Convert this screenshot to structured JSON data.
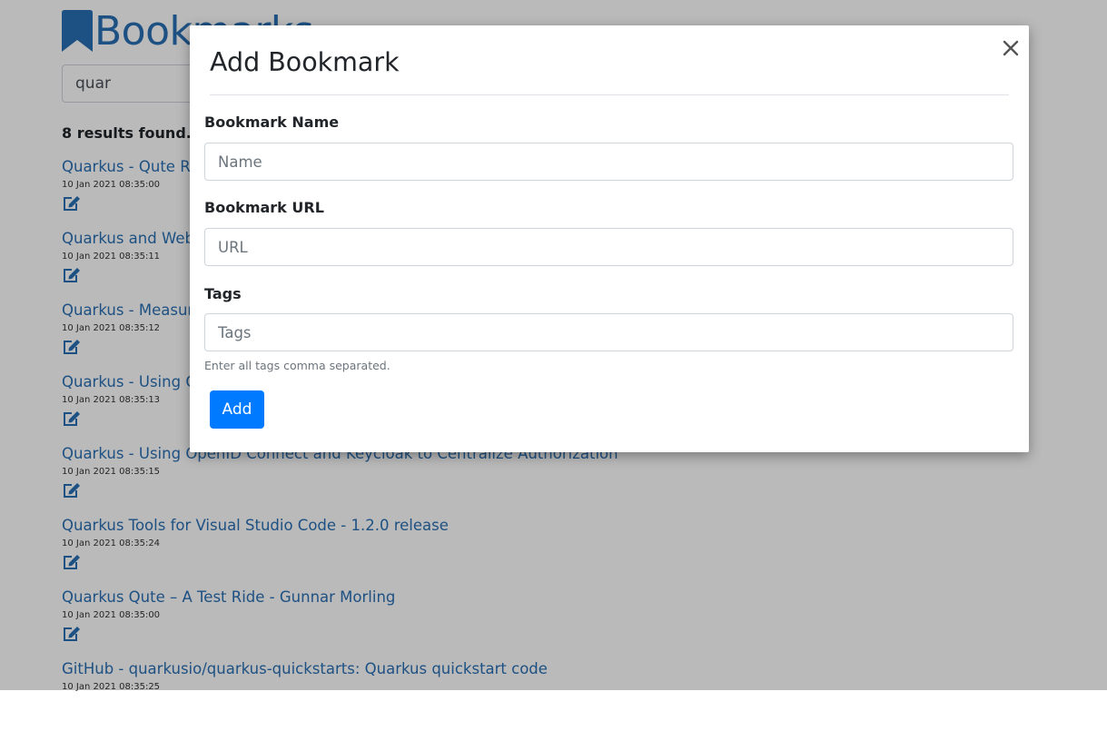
{
  "app": {
    "title": "Bookmarks",
    "brand_color": "#2a6fb4"
  },
  "search": {
    "value": "quar"
  },
  "results": {
    "count_text": "8 results found.",
    "items": [
      {
        "title": "Quarkus - Qute Re",
        "date": "10 Jan 2021 08:35:00"
      },
      {
        "title": "Quarkus and Web",
        "date": "10 Jan 2021 08:35:11"
      },
      {
        "title": "Quarkus - Measur",
        "date": "10 Jan 2021 08:35:12"
      },
      {
        "title": "Quarkus - Using C",
        "date": "10 Jan 2021 08:35:13"
      },
      {
        "title": "Quarkus - Using OpenID Connect and Keycloak to Centralize Authorization",
        "date": "10 Jan 2021 08:35:15"
      },
      {
        "title": "Quarkus Tools for Visual Studio Code - 1.2.0 release",
        "date": "10 Jan 2021 08:35:24"
      },
      {
        "title": "Quarkus Qute – A Test Ride - Gunnar Morling",
        "date": "10 Jan 2021 08:35:00"
      },
      {
        "title": "GitHub - quarkusio/quarkus-quickstarts: Quarkus quickstart code",
        "date": "10 Jan 2021 08:35:25"
      }
    ],
    "edit_icon": "edit-icon"
  },
  "modal": {
    "title": "Add Bookmark",
    "close_icon": "close-icon",
    "name_label": "Bookmark Name",
    "name_placeholder": "Name",
    "url_label": "Bookmark URL",
    "url_placeholder": "URL",
    "tags_label": "Tags",
    "tags_placeholder": "Tags",
    "tags_help": "Enter all tags comma separated.",
    "add_label": "Add",
    "primary_color": "#007bff"
  }
}
